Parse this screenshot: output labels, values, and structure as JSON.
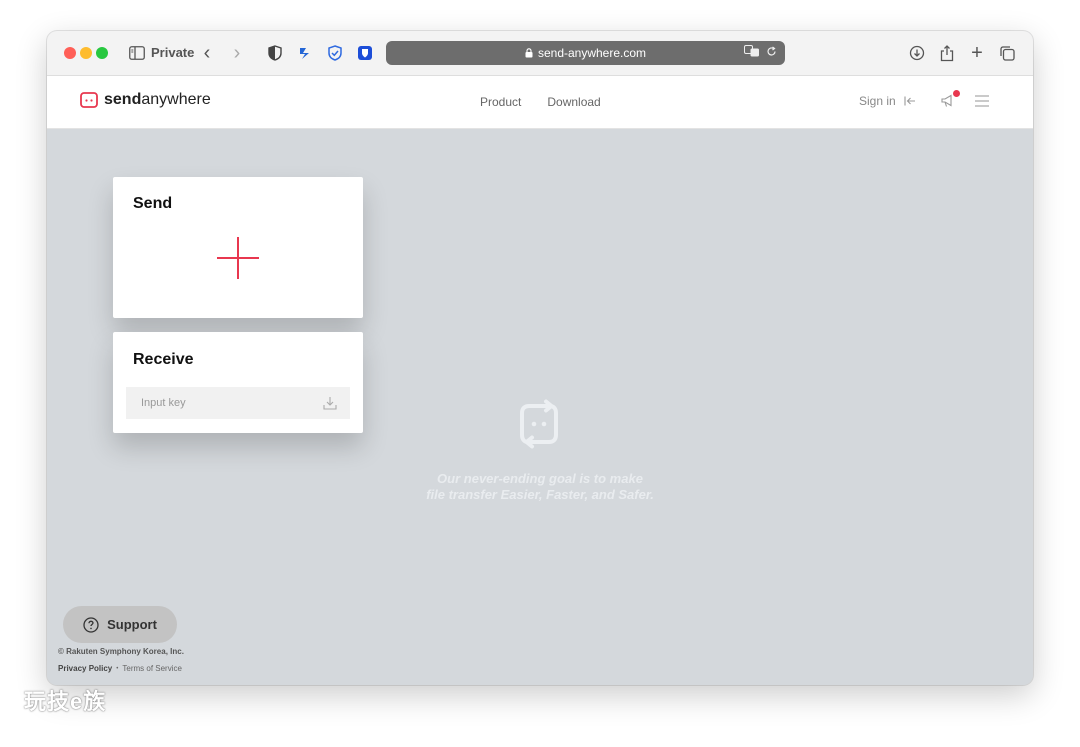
{
  "browser": {
    "mode_label": "Private",
    "address": "send-anywhere.com"
  },
  "header": {
    "logo_bold": "send",
    "logo_rest": "anywhere",
    "nav": [
      "Product",
      "Download"
    ],
    "sign_in": "Sign in"
  },
  "send_card": {
    "title": "Send"
  },
  "receive_card": {
    "title": "Receive",
    "input_placeholder": "Input key",
    "input_value": ""
  },
  "tagline": {
    "line1": "Our never-ending goal is to make",
    "line2": "file transfer Easier, Faster, and Safer."
  },
  "footer": {
    "support_label": "Support",
    "copyright": "© Rakuten Symphony Korea, Inc.",
    "privacy": "Privacy Policy",
    "terms": "Terms of Service"
  },
  "watermark": "玩技e族",
  "colors": {
    "accent": "#e8374f",
    "background": "#d4d8dc",
    "address_bar": "#6d6d6d"
  },
  "icons": [
    "sidebar-icon",
    "back-icon",
    "forward-icon",
    "shield-icon",
    "lock-icon",
    "download-icon",
    "share-icon",
    "new-tab-icon",
    "tabs-icon",
    "megaphone-icon",
    "hamburger-icon",
    "plus-icon",
    "question-icon"
  ]
}
